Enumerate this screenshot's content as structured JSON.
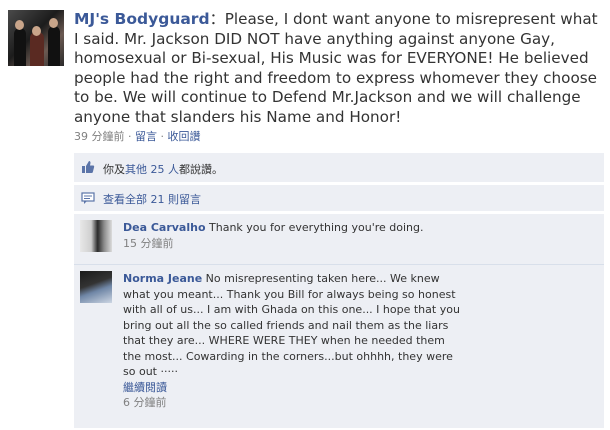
{
  "post": {
    "author": "MJ's Bodyguard",
    "separator": "：",
    "text": "Please, I dont want anyone to misrepresent what I said. Mr. Jackson DID NOT have anything against anyone Gay, homosexual or Bi-sexual, His Music was for EVERYONE! He believed people had the right and freedom to express whomever they choose to be. We will continue to Defend Mr.Jackson and we will challenge anyone that slanders his Name and Honor!",
    "time": "39 分鐘前",
    "dot1": " · ",
    "comment_link": "留言",
    "dot2": " · ",
    "unlike_link": "收回讚"
  },
  "likes": {
    "prefix": "你及",
    "others_link": "其他 25 人",
    "suffix": "都說讚。"
  },
  "view_all": {
    "label": "查看全部 21 則留言"
  },
  "comments": [
    {
      "name": "Dea Carvalho",
      "text": "Thank you for everything you're doing.",
      "time": "15 分鐘前"
    },
    {
      "name": "Norma Jeane",
      "text": "No misrepresenting taken here... We knew what you meant... Thank you Bill for always being so honest with all of us... I am with Ghada on this one... I hope that you bring out all the so called friends and nail them as the liars that they are... WHERE WERE THEY when he needed them the most... Cowarding in the corners...but ohhhh, they were so out ·····",
      "read_more": "繼續閱讀",
      "time": "6 分鐘前"
    }
  ],
  "colors": {
    "link": "#3b5998",
    "box_bg": "#edeff4",
    "meta": "#808080"
  },
  "icons": {
    "like": "thumbs-up-icon",
    "comments": "speech-bubble-icon"
  }
}
